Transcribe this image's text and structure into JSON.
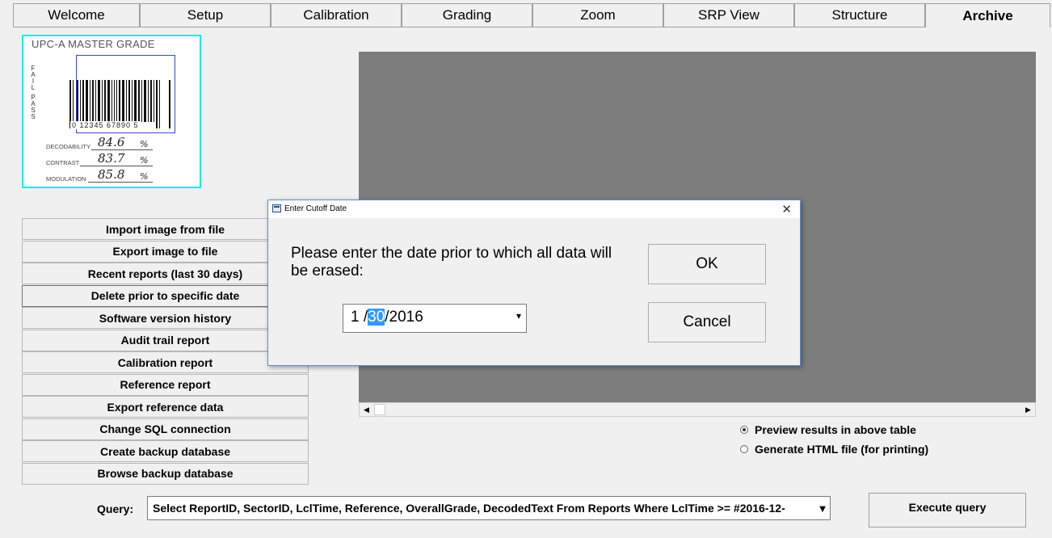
{
  "tabs": [
    {
      "label": "Welcome",
      "active": false
    },
    {
      "label": "Setup",
      "active": false
    },
    {
      "label": "Calibration",
      "active": false
    },
    {
      "label": "Grading",
      "active": false
    },
    {
      "label": "Zoom",
      "active": false
    },
    {
      "label": "SRP View",
      "active": false
    },
    {
      "label": "Structure",
      "active": false
    },
    {
      "label": "Archive",
      "active": true
    }
  ],
  "barcode_image": {
    "title": "UPC-A MASTER GRADE",
    "fail_label": "FAIL",
    "pass_label": "PASS",
    "digits": "0 12345 67890 5",
    "metrics": [
      {
        "label": "DECODABILITY",
        "value": "84.6",
        "unit": "%"
      },
      {
        "label": "CONTRAST",
        "value": "83.7",
        "unit": "%"
      },
      {
        "label": "MODULATION",
        "value": "85.8",
        "unit": "%"
      }
    ]
  },
  "left_buttons": [
    "Import image from file",
    "Export image to file",
    "Recent reports (last 30 days)",
    "Delete prior to specific date",
    "Software version history",
    "Audit trail report",
    "Calibration report",
    "Reference report",
    "Export reference data",
    "Change SQL connection",
    "Create backup database",
    "Browse backup database"
  ],
  "selected_button": "Delete prior to specific date",
  "output_options": {
    "preview_label": "Preview results in above table",
    "html_label": "Generate HTML file (for printing)",
    "selected": "preview"
  },
  "query": {
    "label": "Query:",
    "value": "Select ReportID, SectorID, LclTime, Reference, OverallGrade, DecodedText From Reports Where LclTime >= #2016-12-",
    "execute_label": "Execute query"
  },
  "dialog": {
    "title": "Enter Cutoff Date",
    "prompt": "Please enter the date prior to which all data will be erased:",
    "date_month": "1 /",
    "date_day": "30",
    "date_year": "/2016",
    "ok_label": "OK",
    "cancel_label": "Cancel"
  },
  "colors": {
    "image_border": "#27e6ec",
    "selection_highlight": "#3399ff",
    "grid_background": "#7d7d7d"
  }
}
